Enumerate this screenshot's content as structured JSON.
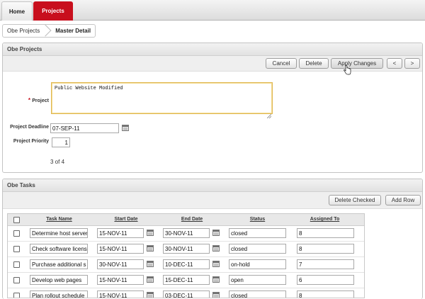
{
  "tabs": [
    {
      "label": "Home",
      "active": false
    },
    {
      "label": "Projects",
      "active": true
    }
  ],
  "breadcrumb": {
    "first": "Obe Projects",
    "current": "Master Detail"
  },
  "projects_region": {
    "title": "Obe Projects",
    "buttons": {
      "cancel": "Cancel",
      "delete": "Delete",
      "apply": "Apply Changes",
      "prev": "<",
      "next": ">"
    },
    "project_label": "Project",
    "project_value": "Public Website Modified",
    "deadline_label": "Project Deadline",
    "deadline_value": "07-SEP-11",
    "priority_label": "Project Priority",
    "priority_value": "1",
    "record_counter": "3 of 4"
  },
  "tasks_region": {
    "title": "Obe Tasks",
    "buttons": {
      "delete_checked": "Delete Checked",
      "add_row": "Add Row"
    },
    "columns": [
      "Task Name",
      "Start Date",
      "End Date",
      "Status",
      "Assigned To"
    ],
    "rows": [
      {
        "task": "Determine host server",
        "start": "15-NOV-11",
        "end": "30-NOV-11",
        "status": "closed",
        "assigned": "8"
      },
      {
        "task": "Check software licens",
        "start": "15-NOV-11",
        "end": "30-NOV-11",
        "status": "closed",
        "assigned": "8"
      },
      {
        "task": "Purchase additional s",
        "start": "30-NOV-11",
        "end": "10-DEC-11",
        "status": "on-hold",
        "assigned": "7"
      },
      {
        "task": "Develop web pages",
        "start": "15-NOV-11",
        "end": "15-DEC-11",
        "status": "open",
        "assigned": "6"
      },
      {
        "task": "Plan rollout schedule",
        "start": "15-NOV-11",
        "end": "03-DEC-11",
        "status": "closed",
        "assigned": "8"
      }
    ]
  },
  "colors": {
    "accent": "#c80f1d",
    "panel_header": "#e6e6e6",
    "field_border": "#a9a9a9",
    "focused_border": "#e0b854"
  },
  "icons": {
    "calendar": "calendar-icon",
    "cursor": "hand-pointer-icon",
    "resize": "resize-handle-icon"
  }
}
